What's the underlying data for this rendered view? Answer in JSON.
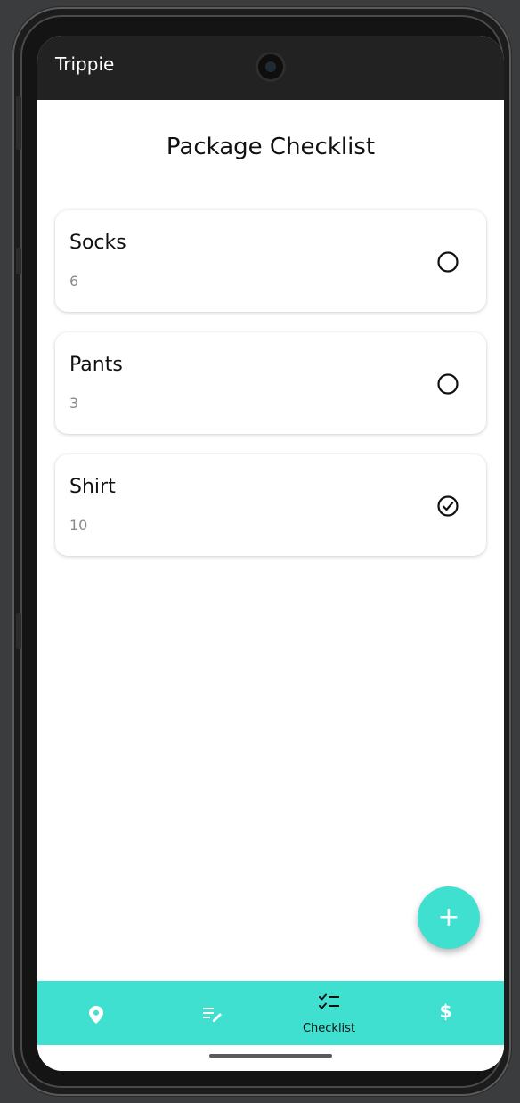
{
  "app": {
    "title": "Trippie"
  },
  "page": {
    "title": "Package Checklist"
  },
  "items": [
    {
      "name": "Socks",
      "quantity": "6",
      "checked": false
    },
    {
      "name": "Pants",
      "quantity": "3",
      "checked": false
    },
    {
      "name": "Shirt",
      "quantity": "10",
      "checked": true
    }
  ],
  "fab": {
    "icon": "plus-icon",
    "label": "+"
  },
  "bottom_nav": {
    "items": [
      {
        "icon": "location-pin-icon",
        "label": ""
      },
      {
        "icon": "edit-list-icon",
        "label": ""
      },
      {
        "icon": "checklist-icon",
        "label": "Checklist",
        "active": true
      },
      {
        "icon": "dollar-icon",
        "label": "$"
      }
    ]
  },
  "colors": {
    "accent": "#3fe0cf",
    "appbar": "#222222",
    "text_primary": "#111111",
    "text_secondary": "#8a8a8a"
  }
}
